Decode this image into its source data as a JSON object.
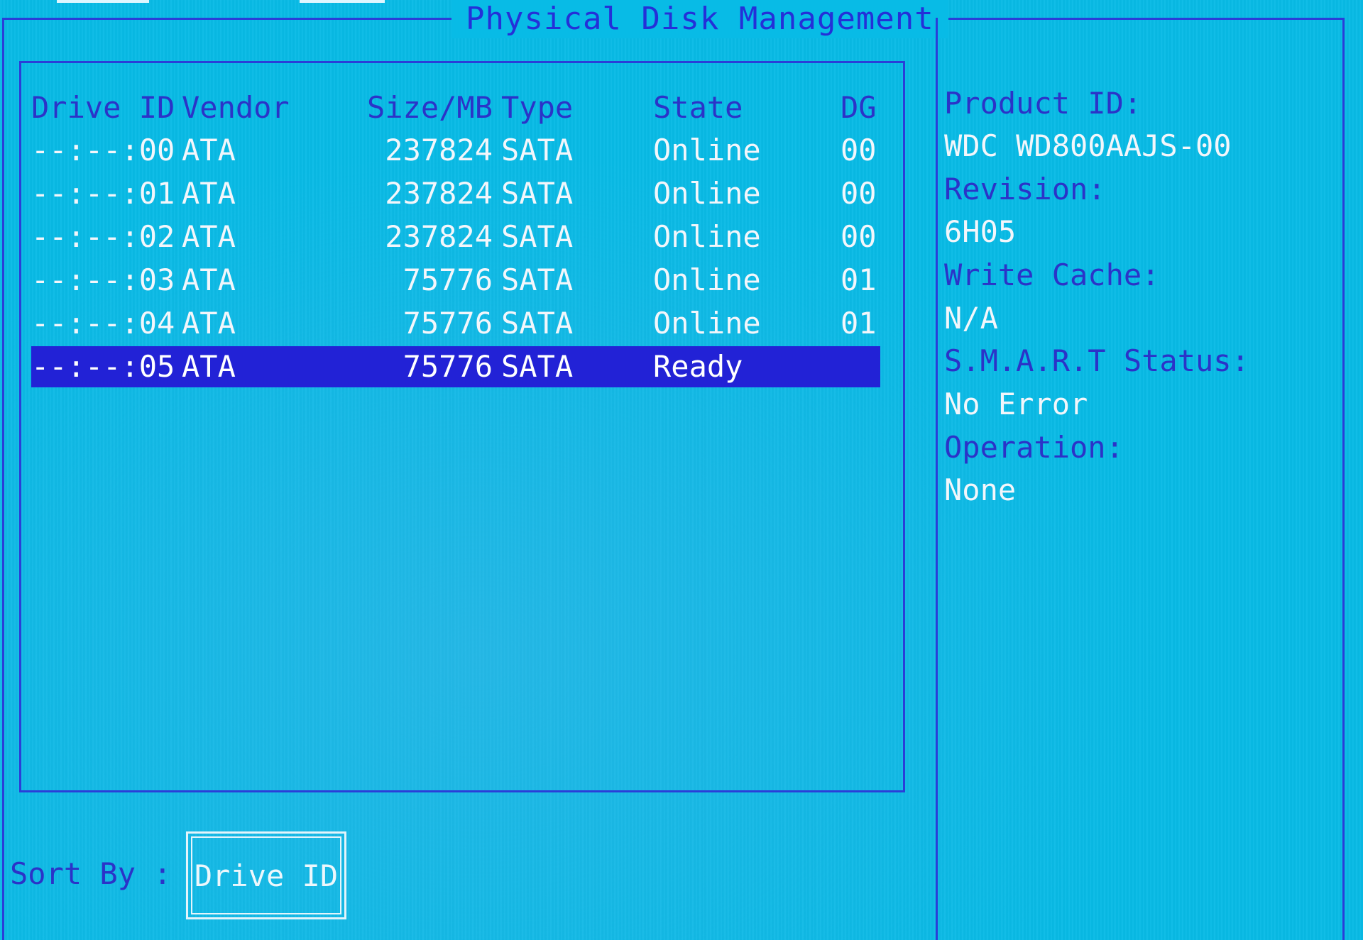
{
  "title": "Physical Disk Management",
  "columns": {
    "drive_id": "Drive ID",
    "vendor": "Vendor",
    "size": "Size/MB",
    "type": "Type",
    "state": "State",
    "dg": "DG"
  },
  "drives": [
    {
      "drive_id": "--:--:00",
      "vendor": "ATA",
      "size": "237824",
      "type": "SATA",
      "state": "Online",
      "dg": "00"
    },
    {
      "drive_id": "--:--:01",
      "vendor": "ATA",
      "size": "237824",
      "type": "SATA",
      "state": "Online",
      "dg": "00"
    },
    {
      "drive_id": "--:--:02",
      "vendor": "ATA",
      "size": "237824",
      "type": "SATA",
      "state": "Online",
      "dg": "00"
    },
    {
      "drive_id": "--:--:03",
      "vendor": "ATA",
      "size": "75776",
      "type": "SATA",
      "state": "Online",
      "dg": "01"
    },
    {
      "drive_id": "--:--:04",
      "vendor": "ATA",
      "size": "75776",
      "type": "SATA",
      "state": "Online",
      "dg": "01"
    },
    {
      "drive_id": "--:--:05",
      "vendor": "ATA",
      "size": "75776",
      "type": "SATA",
      "state": "Ready",
      "dg": "",
      "selected": true
    }
  ],
  "details": {
    "product_id_label": "Product ID:",
    "product_id": "WDC WD800AAJS-00",
    "revision_label": "Revision:",
    "revision": "6H05",
    "write_cache_label": "Write Cache:",
    "write_cache": "N/A",
    "smart_label": "S.M.A.R.T Status:",
    "smart": "No Error",
    "operation_label": "Operation:",
    "operation": "None"
  },
  "sort": {
    "label": "Sort By :",
    "value": "Drive ID"
  },
  "colors": {
    "background": "#08bbe6",
    "frame": "#2a3ed8",
    "label_text": "#2b33c8",
    "value_text": "#f3f6fb",
    "selection": "#2222d6"
  }
}
